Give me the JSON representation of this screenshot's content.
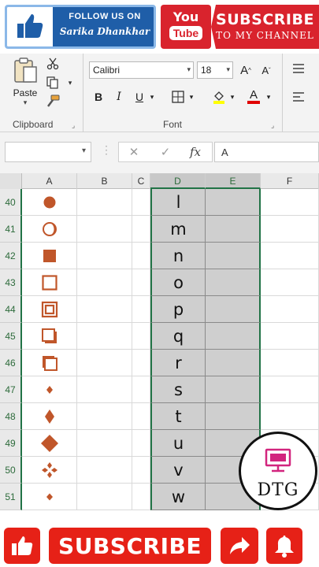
{
  "banner": {
    "follow_line1": "FOLLOW US ON",
    "follow_line2": "Sarika Dhankhar",
    "yt_you": "You",
    "yt_tube": "Tube",
    "subscribe_line1": "SUBSCRIBE",
    "subscribe_line2": "TO MY CHANNEL"
  },
  "ribbon": {
    "clipboard": {
      "paste_label": "Paste",
      "group_label": "Clipboard"
    },
    "font": {
      "font_name": "Calibri",
      "font_size": "18",
      "grow_label": "A",
      "shrink_label": "A",
      "bold": "B",
      "italic": "I",
      "underline": "U",
      "font_color_label": "A",
      "group_label": "Font"
    }
  },
  "formula_bar": {
    "name_box": "",
    "cancel": "✕",
    "enter": "✓",
    "fx": "fx",
    "value": "A"
  },
  "columns": [
    "A",
    "B",
    "C",
    "D",
    "E",
    "F"
  ],
  "rows": [
    {
      "num": "40",
      "shape": "filled-circle",
      "letter": "l"
    },
    {
      "num": "41",
      "shape": "crescent-circle",
      "letter": "m"
    },
    {
      "num": "42",
      "shape": "filled-square",
      "letter": "n"
    },
    {
      "num": "43",
      "shape": "outline-square",
      "letter": "o"
    },
    {
      "num": "44",
      "shape": "double-outline-square",
      "letter": "p"
    },
    {
      "num": "45",
      "shape": "shadow-square-br",
      "letter": "q"
    },
    {
      "num": "46",
      "shape": "shadow-square-tl",
      "letter": "r"
    },
    {
      "num": "47",
      "shape": "small-diamond",
      "letter": "s"
    },
    {
      "num": "48",
      "shape": "medium-diamond",
      "letter": "t"
    },
    {
      "num": "49",
      "shape": "large-diamond",
      "letter": "u"
    },
    {
      "num": "50",
      "shape": "four-diamonds",
      "letter": "v"
    },
    {
      "num": "51",
      "shape": "tiny-diamond",
      "letter": "w"
    }
  ],
  "logo": {
    "text": "DTG"
  },
  "bottom": {
    "subscribe_label": "SUBSCRIBE"
  },
  "colors": {
    "shape": "#c0562a",
    "excel_green": "#217346",
    "youtube_red": "#e62117"
  }
}
